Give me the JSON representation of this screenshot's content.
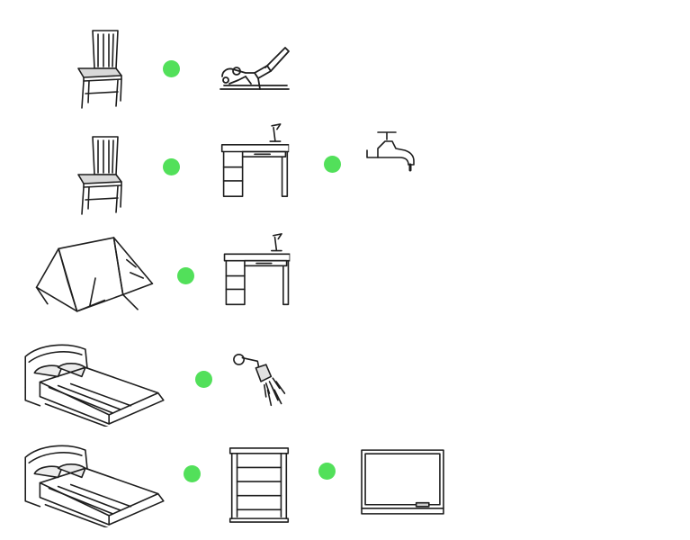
{
  "colors": {
    "dot": "#52e05a",
    "ink": "#1e1e1e",
    "background": "#ffffff"
  },
  "rows": [
    {
      "row": 1,
      "items": [
        "chair-icon",
        "dot",
        "sewing-machine-icon"
      ]
    },
    {
      "row": 2,
      "items": [
        "chair-icon",
        "dot",
        "desk-icon",
        "dot",
        "faucet-icon"
      ]
    },
    {
      "row": 3,
      "items": [
        "tent-icon",
        "dot",
        "desk-icon"
      ]
    },
    {
      "row": 4,
      "items": [
        "bed-icon",
        "dot",
        "shower-head-icon"
      ]
    },
    {
      "row": 5,
      "items": [
        "bed-icon",
        "dot",
        "bookshelf-icon",
        "dot",
        "whiteboard-icon"
      ]
    }
  ]
}
